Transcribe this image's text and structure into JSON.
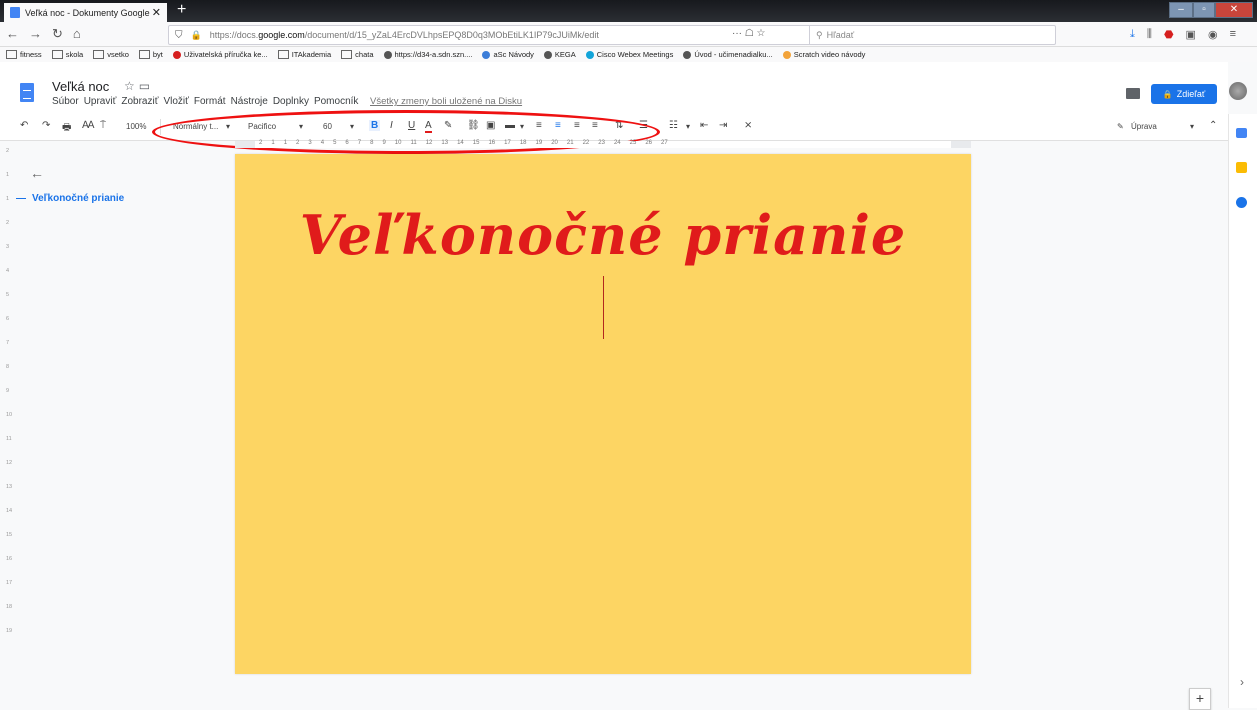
{
  "browser": {
    "tab_title": "Veľká noc - Dokumenty Google",
    "tab_close": "✕",
    "new_tab": "+",
    "url_prefix": "https://docs.",
    "url_domain": "google.com",
    "url_path": "/document/d/15_yZaL4ErcDVLhpsEPQ8D0q3MObEtiLK1IP79cJUiMk/edit",
    "page_actions": "··· ☖ ☆",
    "search_placeholder": "Hľadať",
    "window_buttons": {
      "min": "–",
      "max": "▫",
      "close": "✕"
    }
  },
  "bookmarks": [
    {
      "label": "fitness",
      "type": "folder"
    },
    {
      "label": "skola",
      "type": "folder"
    },
    {
      "label": "vsetko",
      "type": "folder"
    },
    {
      "label": "byt",
      "type": "folder"
    },
    {
      "label": "Uživatelská příručka ke...",
      "type": "link",
      "color": "#d61f1f"
    },
    {
      "label": "ITAkademia",
      "type": "folder"
    },
    {
      "label": "chata",
      "type": "folder"
    },
    {
      "label": "https://d34-a.sdn.szn....",
      "type": "link",
      "color": "#555555"
    },
    {
      "label": "aSc Návody",
      "type": "link",
      "color": "#3b7dd8"
    },
    {
      "label": "KEGA",
      "type": "link",
      "color": "#555555"
    },
    {
      "label": "Cisco Webex Meetings",
      "type": "link",
      "color": "#13a4d9"
    },
    {
      "label": "Úvod - učimenadialku...",
      "type": "link",
      "color": "#555555"
    },
    {
      "label": "Scratch video návody",
      "type": "link",
      "color": "#f2a33a"
    }
  ],
  "docs": {
    "title": "Veľká noc",
    "menu": [
      "Súbor",
      "Upraviť",
      "Zobraziť",
      "Vložiť",
      "Formát",
      "Nástroje",
      "Doplnky",
      "Pomocník"
    ],
    "saved_status": "Všetky zmeny boli uložené na Disku",
    "share_label": "Zdieľať",
    "share_icon": "🔒"
  },
  "toolbar": {
    "zoom": "100%",
    "style": "Normálny t...",
    "font": "Pacifico",
    "size": "60",
    "bold": "B",
    "italic": "I",
    "underline": "U",
    "text_color": "A",
    "mode": "Úprava"
  },
  "ruler_numbers": [
    "2",
    "1",
    "1",
    "2",
    "3",
    "4",
    "5",
    "6",
    "7",
    "8",
    "9",
    "10",
    "11",
    "12",
    "13",
    "14",
    "15",
    "16",
    "17",
    "18",
    "19",
    "20",
    "21",
    "22",
    "23",
    "24",
    "25",
    "26",
    "27"
  ],
  "left_ruler_numbers": [
    "2",
    "1",
    "1",
    "2",
    "3",
    "4",
    "5",
    "6",
    "7",
    "8",
    "9",
    "10",
    "11",
    "12",
    "13",
    "14",
    "15",
    "16",
    "17",
    "18",
    "19"
  ],
  "outline": {
    "heading": "Veľkonočné prianie"
  },
  "document": {
    "heading": "Veľkonočné prianie",
    "page_color": "#fdd563",
    "heading_color": "#e01b1b"
  }
}
